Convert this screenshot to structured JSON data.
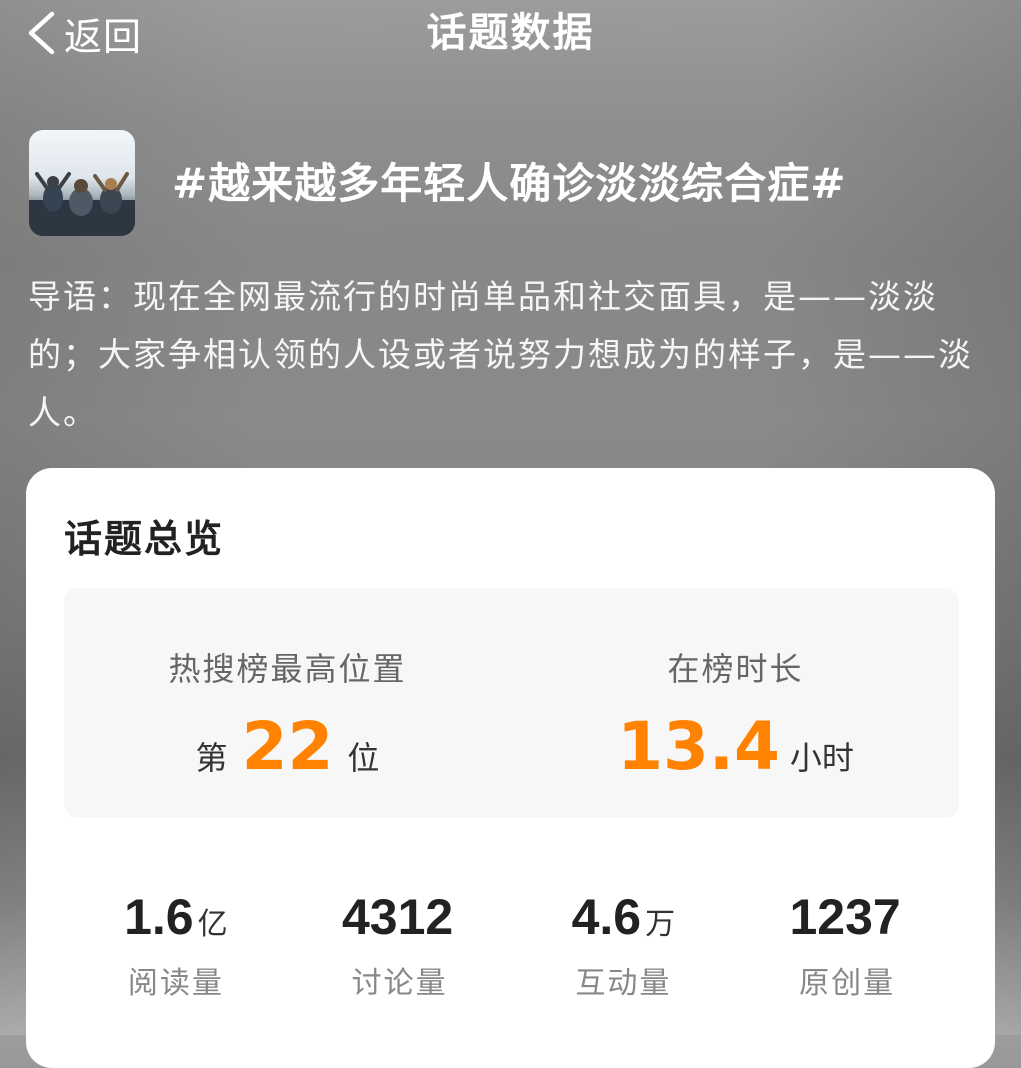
{
  "header": {
    "back_label": "返回",
    "title": "话题数据"
  },
  "topic": {
    "title": "#越来越多年轻人确诊淡淡综合症#",
    "intro": "导语：现在全网最流行的时尚单品和社交面具，是——淡淡的；大家争相认领的人设或者说努力想成为的样子，是——淡人。"
  },
  "overview": {
    "title": "话题总览",
    "rank": {
      "label": "热搜榜最高位置",
      "prefix": "第",
      "value": "22",
      "suffix": "位"
    },
    "duration": {
      "label": "在榜时长",
      "value": "13.4",
      "unit": "小时"
    },
    "stats": [
      {
        "value": "1.6",
        "unit": "亿",
        "label": "阅读量"
      },
      {
        "value": "4312",
        "unit": "",
        "label": "讨论量"
      },
      {
        "value": "4.6",
        "unit": "万",
        "label": "互动量"
      },
      {
        "value": "1237",
        "unit": "",
        "label": "原创量"
      }
    ]
  },
  "colors": {
    "accent": "#ff8200",
    "card_bg": "#ffffff",
    "rank_box_bg": "#f7f7f7"
  }
}
